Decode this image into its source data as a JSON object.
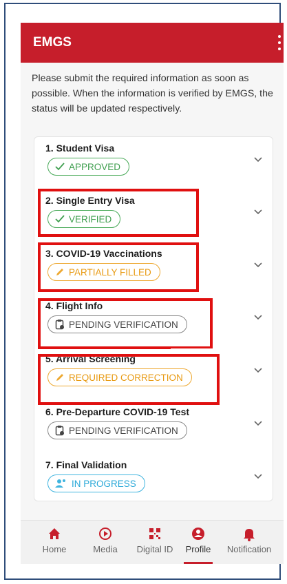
{
  "app": {
    "title": "EMGS"
  },
  "notice": "Please submit the required information as soon as possible. When the information is verified by EMGS, the status will be updated respectively.",
  "steps": [
    {
      "title": "1. Student Visa",
      "status": "APPROVED",
      "status_icon": "check-icon",
      "color": "#3e9e4e"
    },
    {
      "title": "2. Single Entry Visa",
      "status": "VERIFIED",
      "status_icon": "check-icon",
      "color": "#3e9e4e"
    },
    {
      "title": "3. COVID-19 Vaccinations",
      "status": "PARTIALLY FILLED",
      "status_icon": "pencil-icon",
      "color": "#e89a12"
    },
    {
      "title": "4. Flight Info",
      "status": "PENDING VERIFICATION",
      "status_icon": "clipboard-clock-icon",
      "color": "#444444"
    },
    {
      "title": "5. Arrival Screening",
      "status": "REQUIRED CORRECTION",
      "status_icon": "pencil-icon",
      "color": "#e89a12"
    },
    {
      "title": "6. Pre-Departure COVID-19 Test",
      "status": "PENDING VERIFICATION",
      "status_icon": "clipboard-clock-icon",
      "color": "#444444"
    },
    {
      "title": "7. Final Validation",
      "status": "IN PROGRESS",
      "status_icon": "users-icon",
      "color": "#29a8d8"
    }
  ],
  "nav": [
    {
      "label": "Home",
      "icon": "home-icon"
    },
    {
      "label": "Media",
      "icon": "play-circle-icon"
    },
    {
      "label": "Digital ID",
      "icon": "qr-code-icon"
    },
    {
      "label": "Profile",
      "icon": "profile-icon",
      "active": true
    },
    {
      "label": "Notification",
      "icon": "bell-icon"
    }
  ],
  "colors": {
    "brand": "#c61e2b",
    "highlight": "#e01010"
  }
}
